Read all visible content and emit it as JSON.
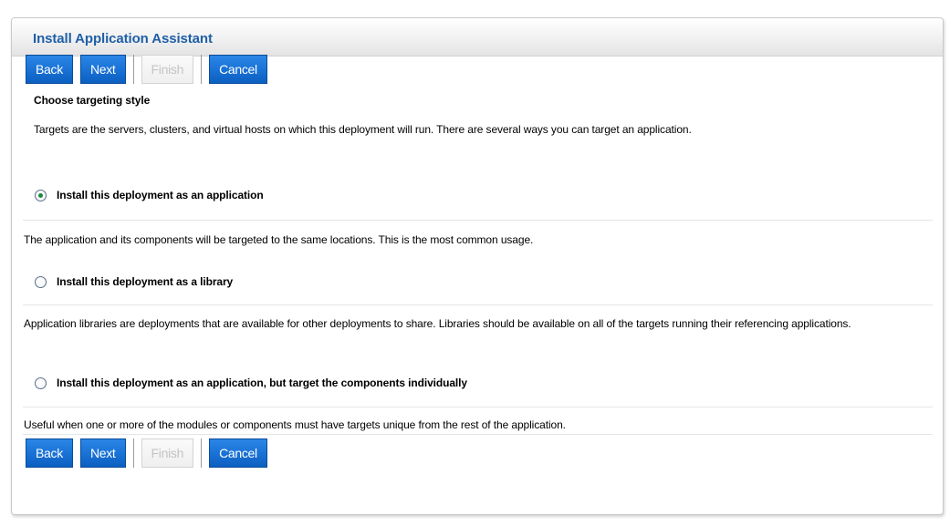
{
  "panel": {
    "title": "Install Application Assistant"
  },
  "toolbar": {
    "back_label": "Back",
    "next_label": "Next",
    "finish_label": "Finish",
    "cancel_label": "Cancel"
  },
  "content": {
    "heading": "Choose targeting style",
    "intro": "Targets are the servers, clusters, and virtual hosts on which this deployment will run. There are several ways you can target an application.",
    "options": [
      {
        "label": "Install this deployment as an application",
        "selected": true,
        "description": "The application and its components will be targeted to the same locations. This is the most common usage."
      },
      {
        "label": "Install this deployment as a library",
        "selected": false,
        "description": "Application libraries are deployments that are available for other deployments to share. Libraries should be available on all of the targets running their referencing applications."
      },
      {
        "label": "Install this deployment as an application, but target the components individually",
        "selected": false,
        "description": "Useful when one or more of the modules or components must have targets unique from the rest of the application."
      }
    ]
  },
  "colors": {
    "title": "#1f5fa8",
    "button": "#1a73d6",
    "radio_checked": "#1c8a3c"
  }
}
